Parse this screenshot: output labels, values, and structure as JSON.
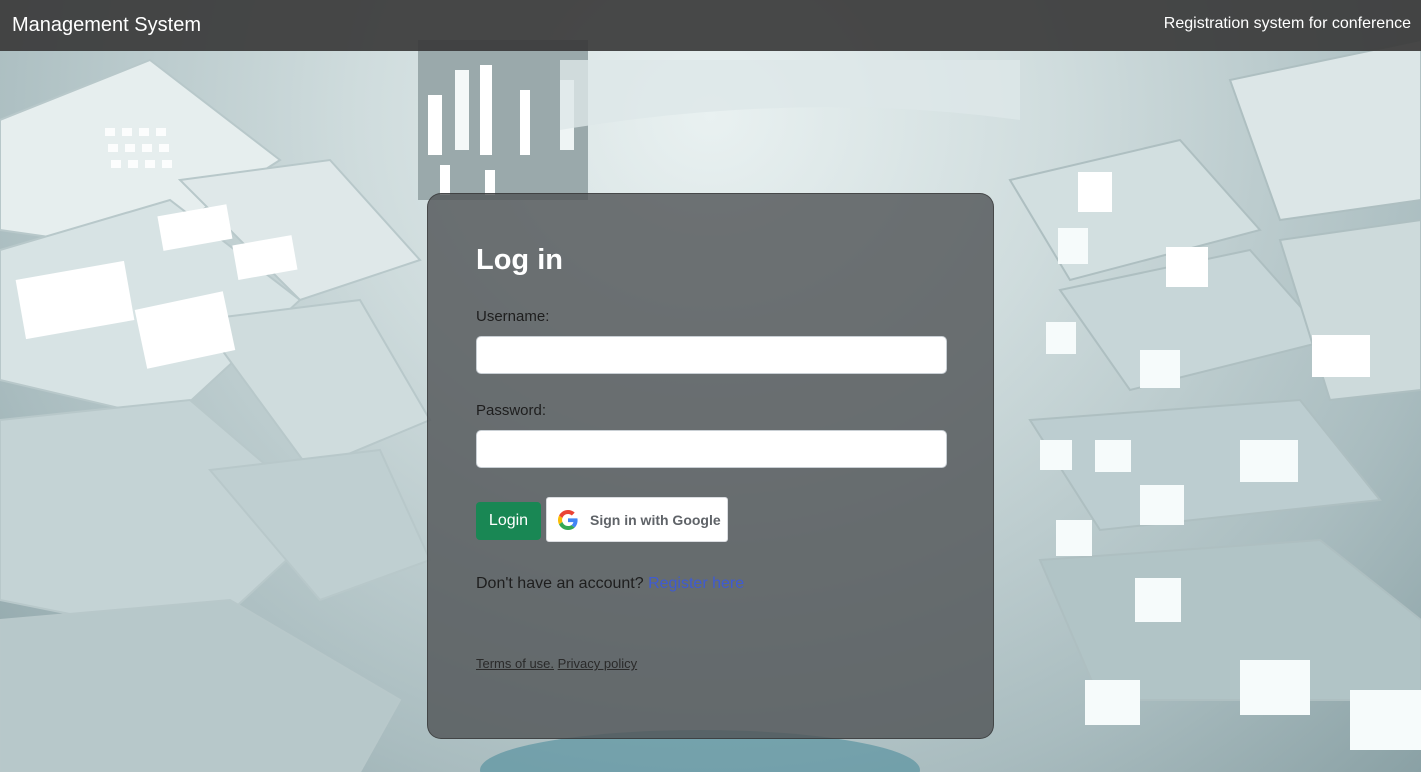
{
  "navbar": {
    "brand": "Management System",
    "right_text": "Registration system for conference"
  },
  "login": {
    "title": "Log in",
    "username_label": "Username:",
    "username_value": "",
    "password_label": "Password:",
    "password_value": "",
    "login_button": "Login",
    "google_button": "Sign in with Google",
    "no_account_text": "Don't have an account?",
    "register_link": "Register here",
    "terms_link": "Terms of use.",
    "privacy_link": "Privacy policy"
  },
  "colors": {
    "navbar_bg": "#3a3a3a",
    "login_button_bg": "#198754",
    "register_link": "#3f5bd1",
    "card_bg": "#525658"
  },
  "icons": {
    "google": "google-g-logo"
  }
}
